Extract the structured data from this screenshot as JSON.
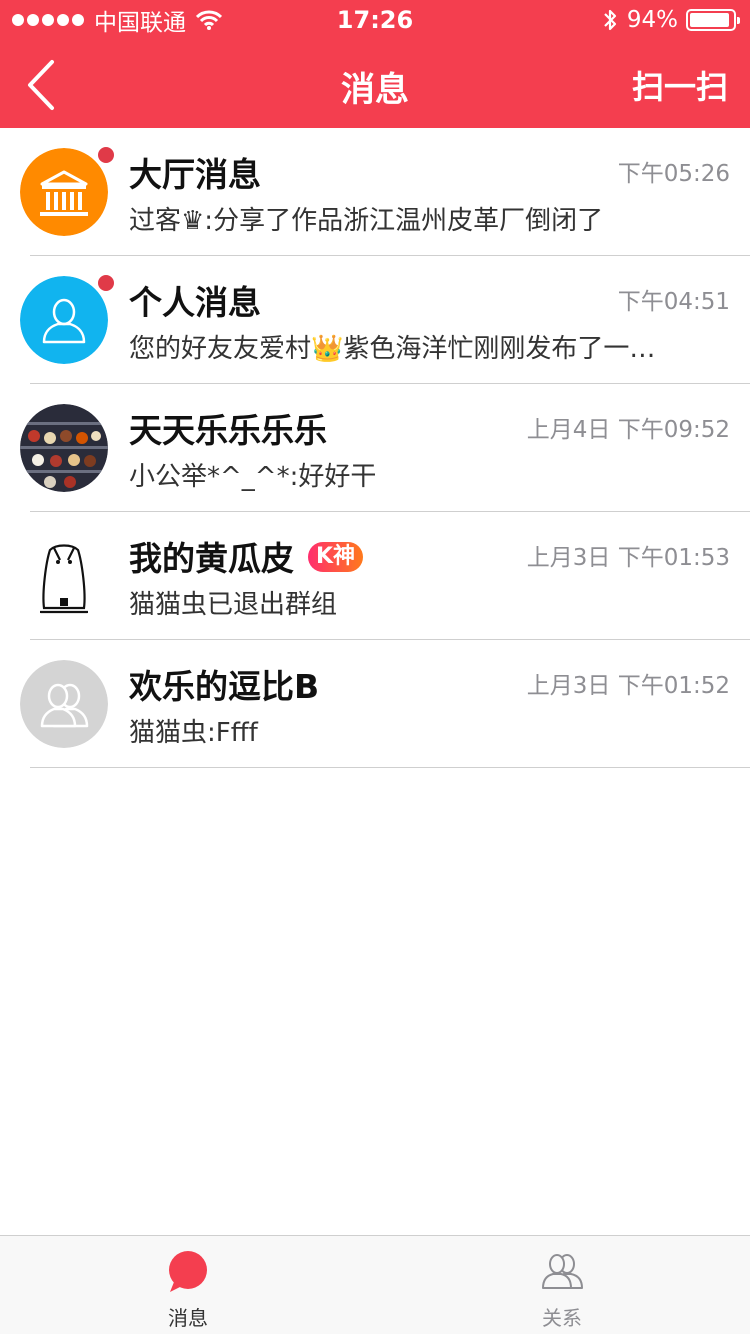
{
  "status_bar": {
    "carrier": "中国联通",
    "time": "17:26",
    "battery": "94%",
    "battery_level": 0.94,
    "signal_icon": "signal-dots-icon",
    "wifi_icon": "wifi-icon",
    "bluetooth_icon": "bluetooth-icon"
  },
  "nav": {
    "title": "消息",
    "back_icon": "chevron-left-icon",
    "action": "扫一扫",
    "color": "#f43e4f"
  },
  "messages": [
    {
      "title": "大厅消息",
      "time": "下午05:26",
      "preview": "过客♛:分享了作品浙江温州皮革厂倒闭了",
      "unread": true,
      "avatar": "building-icon"
    },
    {
      "title": "个人消息",
      "time": "下午04:51",
      "preview": "您的好友友爱村👑紫色海洋忙刚刚发布了一…",
      "unread": true,
      "avatar": "person-icon"
    },
    {
      "title": "天天乐乐乐乐",
      "time": "上月4日 下午09:52",
      "preview": "小公举*^_^*:好好干",
      "unread": false,
      "avatar": "photo-avatar"
    },
    {
      "title": "我的黄瓜皮",
      "time": "上月3日 下午01:53",
      "preview": "猫猫虫已退出群组",
      "unread": false,
      "avatar": "drawing-avatar",
      "badge": "K神"
    },
    {
      "title": "欢乐的逗比B",
      "time": "上月3日 下午01:52",
      "preview": "猫猫虫:Ffff",
      "unread": false,
      "avatar": "group-icon"
    }
  ],
  "tabs": [
    {
      "label": "消息",
      "icon": "chat-bubble-icon",
      "active": true,
      "color": "#f43e4f"
    },
    {
      "label": "关系",
      "icon": "contacts-icon",
      "active": false,
      "color": "#8e8e93"
    }
  ]
}
